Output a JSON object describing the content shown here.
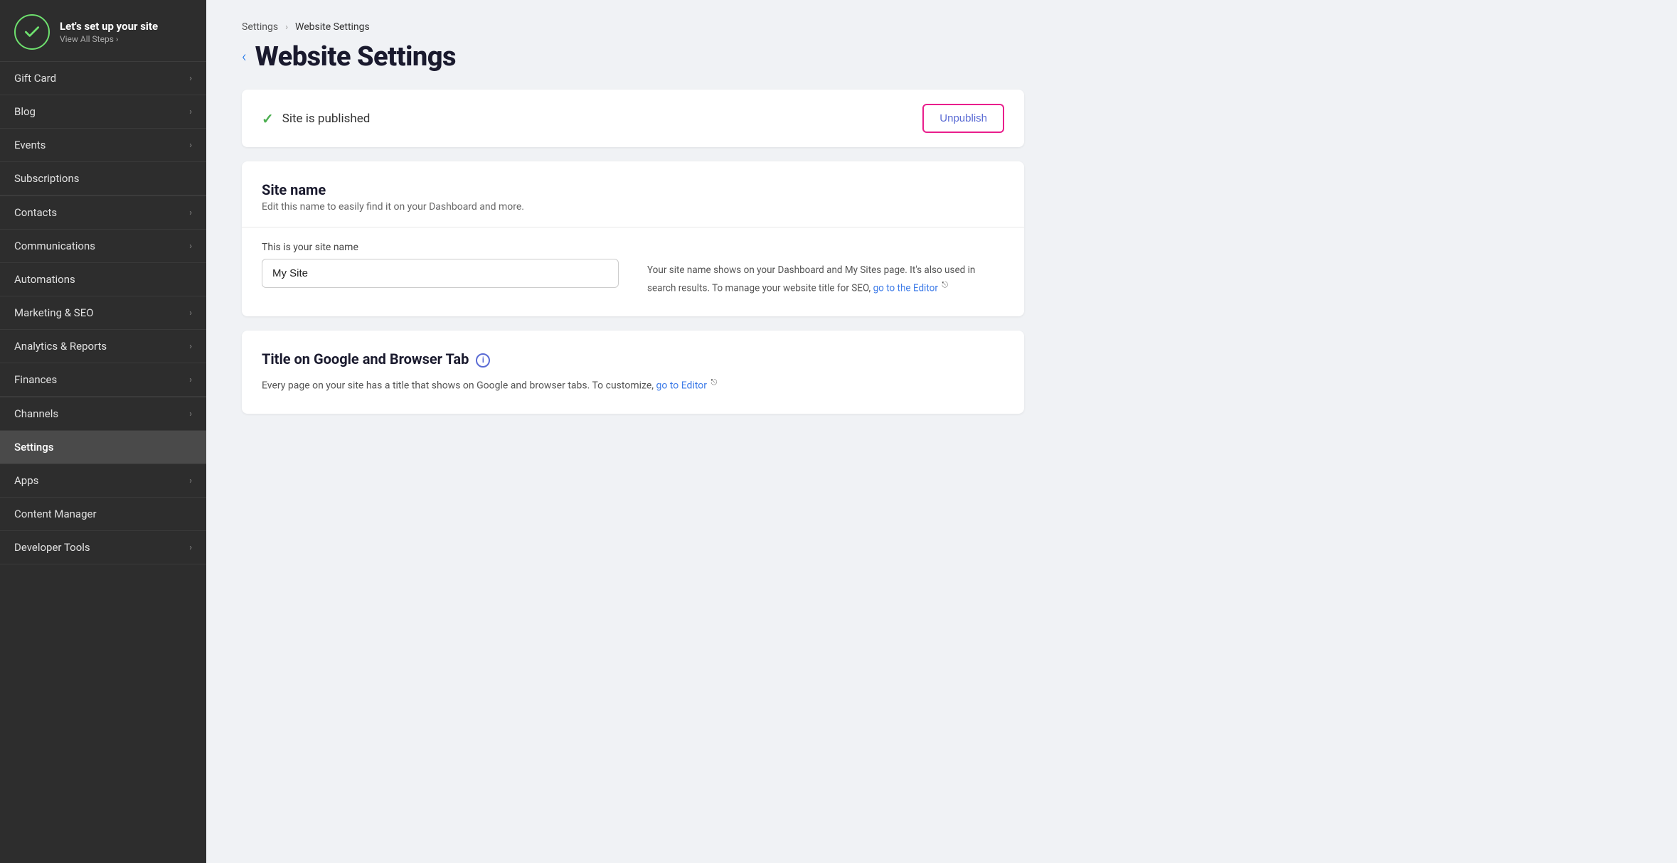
{
  "sidebar": {
    "setup": {
      "title": "Let's set up your site",
      "subtitle": "View All Steps",
      "icon": "check-circle"
    },
    "items": [
      {
        "id": "gift-card",
        "label": "Gift Card",
        "hasChevron": true,
        "active": false
      },
      {
        "id": "blog",
        "label": "Blog",
        "hasChevron": true,
        "active": false
      },
      {
        "id": "events",
        "label": "Events",
        "hasChevron": true,
        "active": false
      },
      {
        "id": "subscriptions",
        "label": "Subscriptions",
        "hasChevron": false,
        "active": false
      },
      {
        "id": "contacts",
        "label": "Contacts",
        "hasChevron": true,
        "active": false
      },
      {
        "id": "communications",
        "label": "Communications",
        "hasChevron": true,
        "active": false
      },
      {
        "id": "automations",
        "label": "Automations",
        "hasChevron": false,
        "active": false
      },
      {
        "id": "marketing-seo",
        "label": "Marketing & SEO",
        "hasChevron": true,
        "active": false
      },
      {
        "id": "analytics-reports",
        "label": "Analytics & Reports",
        "hasChevron": true,
        "active": false
      },
      {
        "id": "finances",
        "label": "Finances",
        "hasChevron": true,
        "active": false
      },
      {
        "id": "channels",
        "label": "Channels",
        "hasChevron": true,
        "active": false
      },
      {
        "id": "settings",
        "label": "Settings",
        "hasChevron": false,
        "active": true
      },
      {
        "id": "apps",
        "label": "Apps",
        "hasChevron": true,
        "active": false
      },
      {
        "id": "content-manager",
        "label": "Content Manager",
        "hasChevron": false,
        "active": false
      },
      {
        "id": "developer-tools",
        "label": "Developer Tools",
        "hasChevron": true,
        "active": false
      }
    ]
  },
  "breadcrumb": {
    "parent": "Settings",
    "current": "Website Settings"
  },
  "page": {
    "title": "Website Settings"
  },
  "published_bar": {
    "status_text": "Site is published",
    "unpublish_label": "Unpublish"
  },
  "site_name_section": {
    "title": "Site name",
    "description": "Edit this name to easily find it on your Dashboard and more.",
    "field_label": "This is your site name",
    "field_value": "My Site",
    "help_text": "Your site name shows on your Dashboard and My Sites page. It's also used in search results. To manage your website title for SEO,",
    "help_link_text": "go to the Editor",
    "help_link_suffix": ""
  },
  "google_title_section": {
    "title": "Title on Google and Browser Tab",
    "description": "Every page on your site has a title that shows on Google and browser tabs. To customize,",
    "link_text": "go to Editor"
  }
}
